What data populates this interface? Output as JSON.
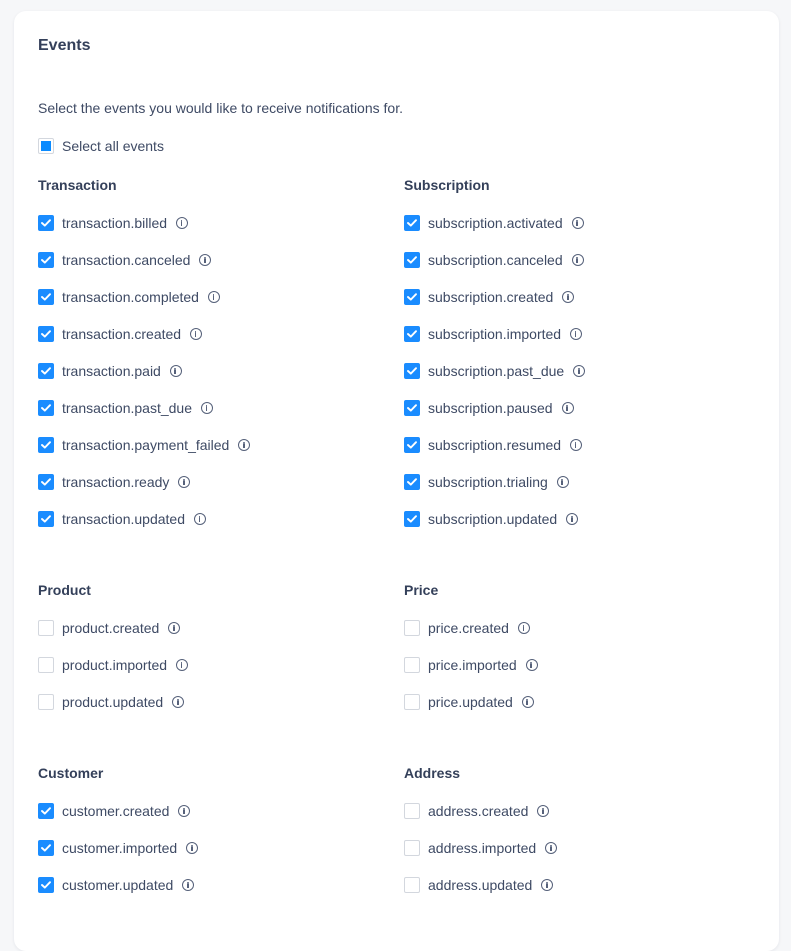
{
  "title": "Events",
  "intro": "Select the events you would like to receive notifications for.",
  "select_all": {
    "label": "Select all events",
    "state": "indeterminate"
  },
  "colors": {
    "accent": "#1a8cff",
    "text": "#3e4a64",
    "heading": "#34405a"
  },
  "groups": [
    {
      "title": "Transaction",
      "column": "left",
      "events": [
        {
          "name": "transaction.billed",
          "checked": true
        },
        {
          "name": "transaction.canceled",
          "checked": true
        },
        {
          "name": "transaction.completed",
          "checked": true
        },
        {
          "name": "transaction.created",
          "checked": true
        },
        {
          "name": "transaction.paid",
          "checked": true
        },
        {
          "name": "transaction.past_due",
          "checked": true
        },
        {
          "name": "transaction.payment_failed",
          "checked": true
        },
        {
          "name": "transaction.ready",
          "checked": true
        },
        {
          "name": "transaction.updated",
          "checked": true
        }
      ]
    },
    {
      "title": "Subscription",
      "column": "right",
      "events": [
        {
          "name": "subscription.activated",
          "checked": true
        },
        {
          "name": "subscription.canceled",
          "checked": true
        },
        {
          "name": "subscription.created",
          "checked": true
        },
        {
          "name": "subscription.imported",
          "checked": true
        },
        {
          "name": "subscription.past_due",
          "checked": true
        },
        {
          "name": "subscription.paused",
          "checked": true
        },
        {
          "name": "subscription.resumed",
          "checked": true
        },
        {
          "name": "subscription.trialing",
          "checked": true
        },
        {
          "name": "subscription.updated",
          "checked": true
        }
      ]
    },
    {
      "title": "Product",
      "column": "left",
      "events": [
        {
          "name": "product.created",
          "checked": false
        },
        {
          "name": "product.imported",
          "checked": false
        },
        {
          "name": "product.updated",
          "checked": false
        }
      ]
    },
    {
      "title": "Price",
      "column": "right",
      "events": [
        {
          "name": "price.created",
          "checked": false
        },
        {
          "name": "price.imported",
          "checked": false
        },
        {
          "name": "price.updated",
          "checked": false
        }
      ]
    },
    {
      "title": "Customer",
      "column": "left",
      "events": [
        {
          "name": "customer.created",
          "checked": true
        },
        {
          "name": "customer.imported",
          "checked": true
        },
        {
          "name": "customer.updated",
          "checked": true
        }
      ]
    },
    {
      "title": "Address",
      "column": "right",
      "events": [
        {
          "name": "address.created",
          "checked": false
        },
        {
          "name": "address.imported",
          "checked": false
        },
        {
          "name": "address.updated",
          "checked": false
        }
      ]
    }
  ]
}
